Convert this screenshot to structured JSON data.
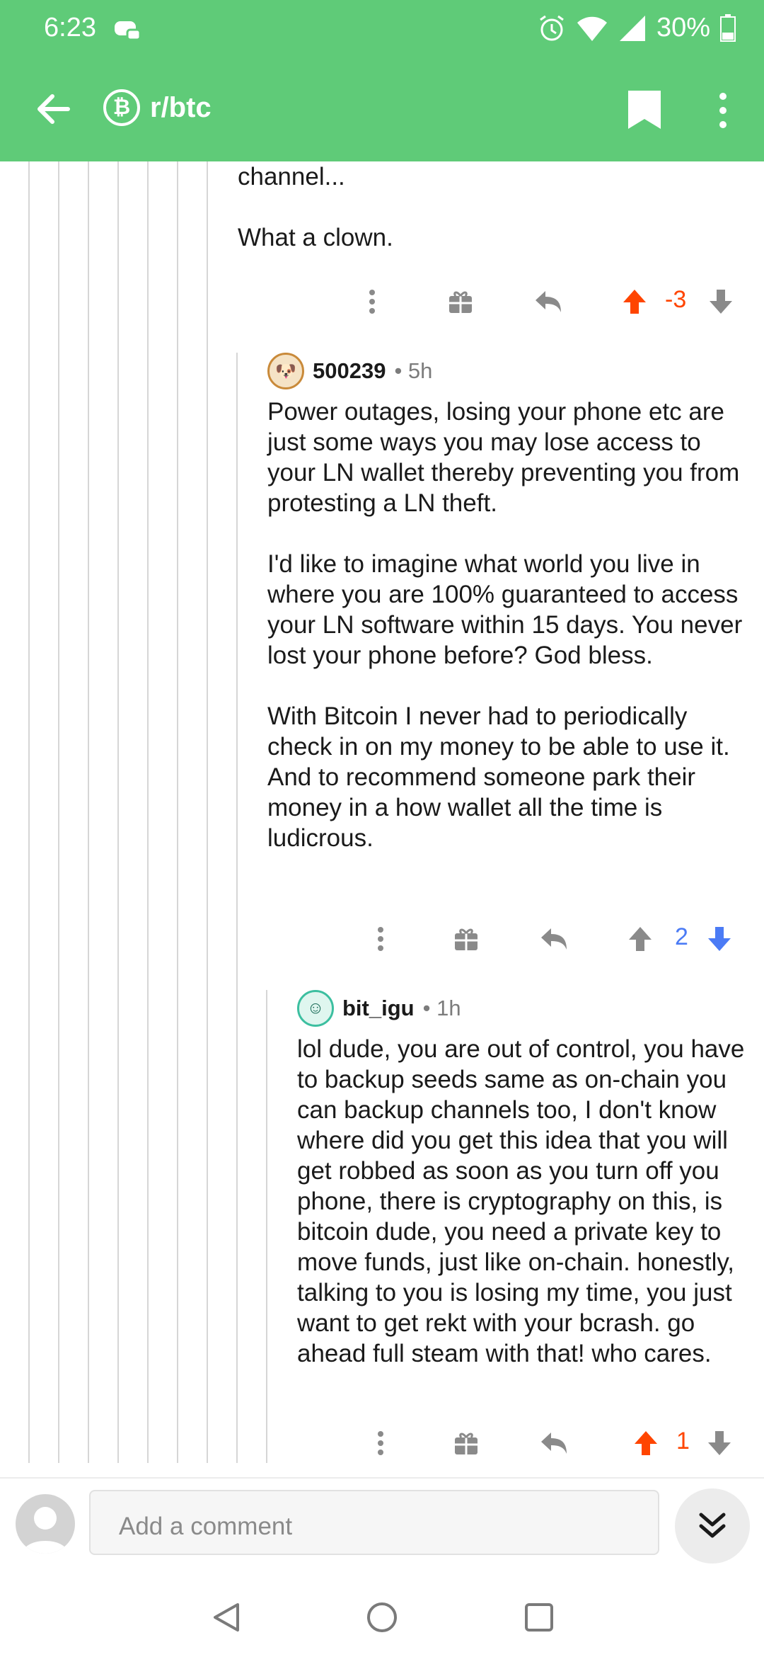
{
  "status_bar": {
    "time": "6:23",
    "battery": "30%"
  },
  "app_bar": {
    "subreddit": "r/btc",
    "btc_symbol": "₿"
  },
  "comments": [
    {
      "text": "channel...\n\nWhat a clown.",
      "score": "-3",
      "vote": "up"
    },
    {
      "username": "500239",
      "meta": "• 5h",
      "text": "Power outages, losing your phone etc are just some ways you may lose access to your LN wallet thereby preventing you from protesting a LN theft.\n\nI'd like to imagine what world you live in where you are 100% guaranteed to access your LN software within 15 days. You never lost your phone before? God bless.\n\nWith Bitcoin I never had to periodically check in on my money to be able to use it. And to recommend someone park their money in a how wallet all the time is ludicrous.",
      "score": "2",
      "vote": "down"
    },
    {
      "username": "bit_igu",
      "meta": "• 1h",
      "text": "lol dude, you are out of control, you have to backup seeds  same as on-chain you can backup channels  too, I don't know where did you get this idea that you will get robbed as soon as you turn off you phone, there is cryptography on this, is bitcoin dude, you need a private key to move funds, just like on-chain. honestly, talking to you is losing my time, you just want to get rekt with your bcrash. go ahead full steam with that! who cares.",
      "score": "1",
      "vote": "up"
    }
  ],
  "comment_bar": {
    "placeholder": "Add a comment"
  },
  "colors": {
    "accent_green": "#5fcb78",
    "upvote_orange": "#ff4500",
    "downvote_blue": "#4b7bf5",
    "icon_gray": "#8a8a8a"
  },
  "icons": [
    "back-arrow-icon",
    "bitcoin-icon",
    "bookmark-icon",
    "more-vert-icon",
    "gift-icon",
    "reply-icon",
    "upvote-icon",
    "downvote-icon",
    "chevron-double-down-icon",
    "nav-back-icon",
    "nav-home-icon",
    "nav-recents-icon"
  ]
}
